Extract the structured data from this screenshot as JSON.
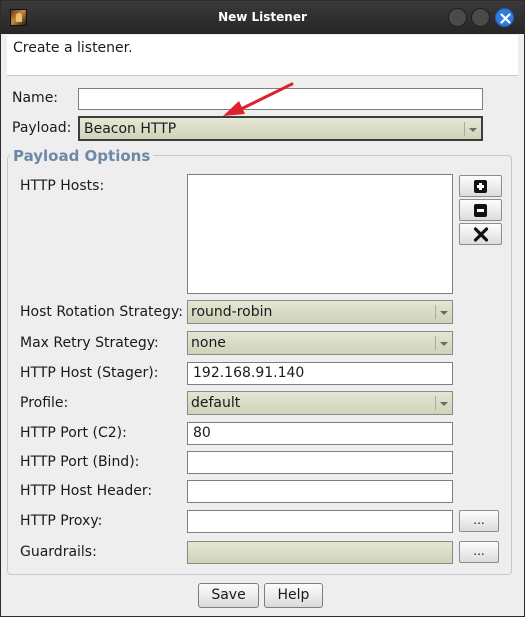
{
  "window": {
    "title": "New Listener"
  },
  "description": "Create a listener.",
  "name": {
    "label": "Name:",
    "value": ""
  },
  "payload": {
    "label": "Payload:",
    "value": "Beacon HTTP"
  },
  "payload_options": {
    "title": "Payload Options",
    "http_hosts": {
      "label": "HTTP Hosts:",
      "values": []
    },
    "host_rotation": {
      "label": "Host Rotation Strategy:",
      "value": "round-robin"
    },
    "max_retry": {
      "label": "Max Retry Strategy:",
      "value": "none"
    },
    "host_stager": {
      "label": "HTTP Host (Stager):",
      "value": "192.168.91.140"
    },
    "profile": {
      "label": "Profile:",
      "value": "default"
    },
    "port_c2": {
      "label": "HTTP Port (C2):",
      "value": "80"
    },
    "port_bind": {
      "label": "HTTP Port (Bind):",
      "value": ""
    },
    "host_header": {
      "label": "HTTP Host Header:",
      "value": ""
    },
    "proxy": {
      "label": "HTTP Proxy:",
      "value": "",
      "button": "..."
    },
    "guardrails": {
      "label": "Guardrails:",
      "value": "",
      "button": "..."
    }
  },
  "buttons": {
    "save": "Save",
    "help": "Help"
  },
  "icons": {
    "app": "cobalt-strike-app-icon",
    "add": "plus-icon",
    "remove": "minus-icon",
    "clear": "x-icon",
    "annotation": "red-arrow-icon"
  },
  "colors": {
    "annotation_arrow": "#e0202a",
    "close_button": "#2f7de1",
    "legend": "#6e88a8"
  }
}
